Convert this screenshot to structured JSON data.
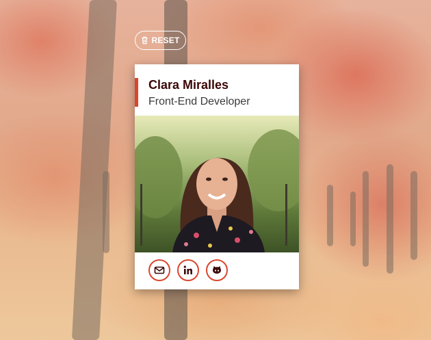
{
  "toolbar": {
    "reset_label": "RESET",
    "reset_icon": "trash-icon"
  },
  "profile": {
    "name": "Clara Miralles",
    "role": "Front-End Developer",
    "accent_color": "#d9452b",
    "name_color": "#3b0606"
  },
  "social": [
    {
      "icon": "mail-icon"
    },
    {
      "icon": "linkedin-icon"
    },
    {
      "icon": "github-icon"
    }
  ]
}
